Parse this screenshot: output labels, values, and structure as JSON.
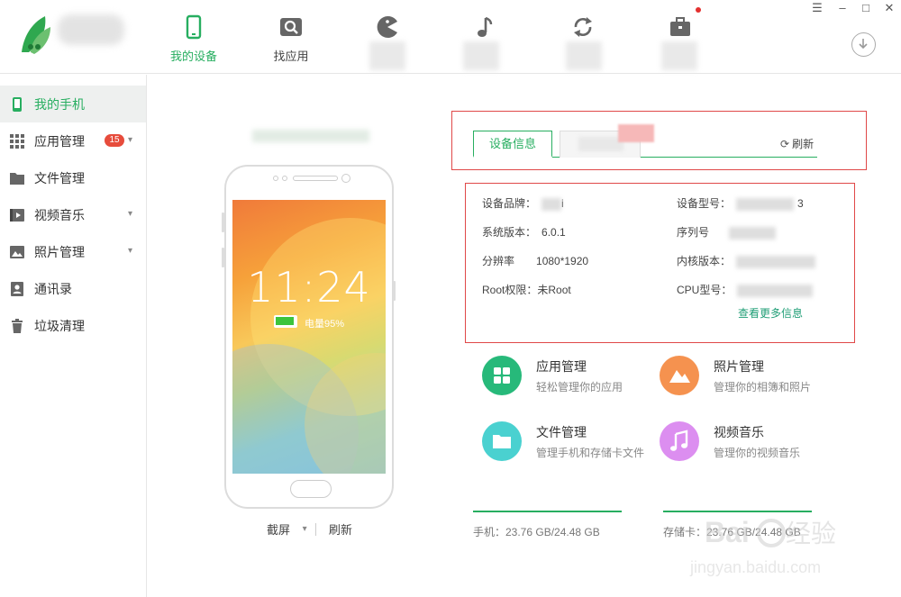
{
  "topbar": {
    "tabs": [
      {
        "label": "我的设备",
        "icon": "phone-icon"
      },
      {
        "label": "找应用",
        "icon": "search-icon"
      },
      {
        "label": "",
        "icon": "pacman-icon"
      },
      {
        "label": "",
        "icon": "music-note-icon"
      },
      {
        "label": "",
        "icon": "sync-icon"
      },
      {
        "label": "",
        "icon": "toolbox-icon"
      }
    ],
    "window_controls": [
      "☰",
      "–",
      "□",
      "✕"
    ]
  },
  "sidebar": {
    "items": [
      {
        "label": "我的手机",
        "icon": "phone-icon"
      },
      {
        "label": "应用管理",
        "icon": "grid-icon",
        "badge": "15"
      },
      {
        "label": "文件管理",
        "icon": "folder-icon"
      },
      {
        "label": "视频音乐",
        "icon": "video-icon"
      },
      {
        "label": "照片管理",
        "icon": "photo-icon"
      },
      {
        "label": "通讯录",
        "icon": "contacts-icon"
      },
      {
        "label": "垃圾清理",
        "icon": "trash-icon"
      }
    ]
  },
  "phone": {
    "time": "11:24",
    "battery_label": "电量95%",
    "battery_level": 0.95,
    "actions": {
      "screenshot": "截屏",
      "refresh": "刷新"
    }
  },
  "info_panel": {
    "tab_device_info": "设备信息",
    "refresh": "刷新",
    "rows_left": [
      {
        "label": "设备品牌：",
        "value": "i"
      },
      {
        "label": "系统版本：",
        "value": "6.0.1"
      },
      {
        "label": "分辨率",
        "value": "1080*1920"
      },
      {
        "label": "Root权限：",
        "value": "未Root"
      }
    ],
    "rows_right": [
      {
        "label": "设备型号：",
        "value": "3"
      },
      {
        "label": "序列号",
        "value": ""
      },
      {
        "label": "内核版本：",
        "value": ""
      },
      {
        "label": "CPU型号：",
        "value": ""
      }
    ],
    "more_link": "查看更多信息"
  },
  "features": [
    {
      "title": "应用管理",
      "desc": "轻松管理你的应用",
      "color": "#27b97a",
      "icon": "grid-icon"
    },
    {
      "title": "照片管理",
      "desc": "管理你的相簿和照片",
      "color": "#f5924f",
      "icon": "mountain-icon"
    },
    {
      "title": "文件管理",
      "desc": "管理手机和存储卡文件",
      "color": "#4ad1d0",
      "icon": "folder-icon"
    },
    {
      "title": "视频音乐",
      "desc": "管理你的视频音乐",
      "color": "#dc8ef0",
      "icon": "music-note-icon"
    }
  ],
  "storage": {
    "phone": "手机：23.76 GB/24.48 GB",
    "phone_used": 0.97,
    "card": "存储卡：23.76 GB/24.48 GB",
    "card_used": 0.97
  },
  "colors": {
    "accent": "#27ae60",
    "highlight": "#e04848",
    "badge": "#e74c3c"
  }
}
